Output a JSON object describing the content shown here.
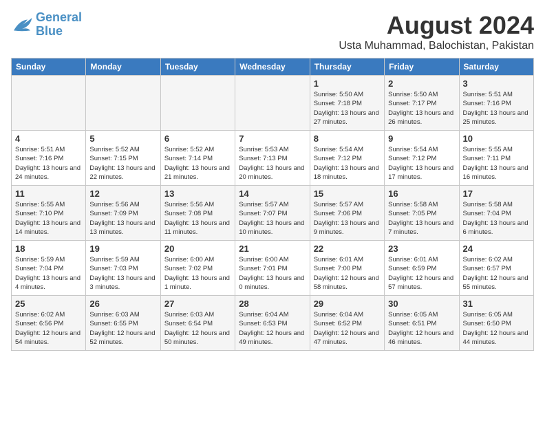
{
  "logo": {
    "line1": "General",
    "line2": "Blue"
  },
  "title": "August 2024",
  "subtitle": "Usta Muhammad, Balochistan, Pakistan",
  "headers": [
    "Sunday",
    "Monday",
    "Tuesday",
    "Wednesday",
    "Thursday",
    "Friday",
    "Saturday"
  ],
  "weeks": [
    [
      {
        "day": "",
        "sunrise": "",
        "sunset": "",
        "daylight": ""
      },
      {
        "day": "",
        "sunrise": "",
        "sunset": "",
        "daylight": ""
      },
      {
        "day": "",
        "sunrise": "",
        "sunset": "",
        "daylight": ""
      },
      {
        "day": "",
        "sunrise": "",
        "sunset": "",
        "daylight": ""
      },
      {
        "day": "1",
        "sunrise": "Sunrise: 5:50 AM",
        "sunset": "Sunset: 7:18 PM",
        "daylight": "Daylight: 13 hours and 27 minutes."
      },
      {
        "day": "2",
        "sunrise": "Sunrise: 5:50 AM",
        "sunset": "Sunset: 7:17 PM",
        "daylight": "Daylight: 13 hours and 26 minutes."
      },
      {
        "day": "3",
        "sunrise": "Sunrise: 5:51 AM",
        "sunset": "Sunset: 7:16 PM",
        "daylight": "Daylight: 13 hours and 25 minutes."
      }
    ],
    [
      {
        "day": "4",
        "sunrise": "Sunrise: 5:51 AM",
        "sunset": "Sunset: 7:16 PM",
        "daylight": "Daylight: 13 hours and 24 minutes."
      },
      {
        "day": "5",
        "sunrise": "Sunrise: 5:52 AM",
        "sunset": "Sunset: 7:15 PM",
        "daylight": "Daylight: 13 hours and 22 minutes."
      },
      {
        "day": "6",
        "sunrise": "Sunrise: 5:52 AM",
        "sunset": "Sunset: 7:14 PM",
        "daylight": "Daylight: 13 hours and 21 minutes."
      },
      {
        "day": "7",
        "sunrise": "Sunrise: 5:53 AM",
        "sunset": "Sunset: 7:13 PM",
        "daylight": "Daylight: 13 hours and 20 minutes."
      },
      {
        "day": "8",
        "sunrise": "Sunrise: 5:54 AM",
        "sunset": "Sunset: 7:12 PM",
        "daylight": "Daylight: 13 hours and 18 minutes."
      },
      {
        "day": "9",
        "sunrise": "Sunrise: 5:54 AM",
        "sunset": "Sunset: 7:12 PM",
        "daylight": "Daylight: 13 hours and 17 minutes."
      },
      {
        "day": "10",
        "sunrise": "Sunrise: 5:55 AM",
        "sunset": "Sunset: 7:11 PM",
        "daylight": "Daylight: 13 hours and 16 minutes."
      }
    ],
    [
      {
        "day": "11",
        "sunrise": "Sunrise: 5:55 AM",
        "sunset": "Sunset: 7:10 PM",
        "daylight": "Daylight: 13 hours and 14 minutes."
      },
      {
        "day": "12",
        "sunrise": "Sunrise: 5:56 AM",
        "sunset": "Sunset: 7:09 PM",
        "daylight": "Daylight: 13 hours and 13 minutes."
      },
      {
        "day": "13",
        "sunrise": "Sunrise: 5:56 AM",
        "sunset": "Sunset: 7:08 PM",
        "daylight": "Daylight: 13 hours and 11 minutes."
      },
      {
        "day": "14",
        "sunrise": "Sunrise: 5:57 AM",
        "sunset": "Sunset: 7:07 PM",
        "daylight": "Daylight: 13 hours and 10 minutes."
      },
      {
        "day": "15",
        "sunrise": "Sunrise: 5:57 AM",
        "sunset": "Sunset: 7:06 PM",
        "daylight": "Daylight: 13 hours and 9 minutes."
      },
      {
        "day": "16",
        "sunrise": "Sunrise: 5:58 AM",
        "sunset": "Sunset: 7:05 PM",
        "daylight": "Daylight: 13 hours and 7 minutes."
      },
      {
        "day": "17",
        "sunrise": "Sunrise: 5:58 AM",
        "sunset": "Sunset: 7:04 PM",
        "daylight": "Daylight: 13 hours and 6 minutes."
      }
    ],
    [
      {
        "day": "18",
        "sunrise": "Sunrise: 5:59 AM",
        "sunset": "Sunset: 7:04 PM",
        "daylight": "Daylight: 13 hours and 4 minutes."
      },
      {
        "day": "19",
        "sunrise": "Sunrise: 5:59 AM",
        "sunset": "Sunset: 7:03 PM",
        "daylight": "Daylight: 13 hours and 3 minutes."
      },
      {
        "day": "20",
        "sunrise": "Sunrise: 6:00 AM",
        "sunset": "Sunset: 7:02 PM",
        "daylight": "Daylight: 13 hours and 1 minute."
      },
      {
        "day": "21",
        "sunrise": "Sunrise: 6:00 AM",
        "sunset": "Sunset: 7:01 PM",
        "daylight": "Daylight: 13 hours and 0 minutes."
      },
      {
        "day": "22",
        "sunrise": "Sunrise: 6:01 AM",
        "sunset": "Sunset: 7:00 PM",
        "daylight": "Daylight: 12 hours and 58 minutes."
      },
      {
        "day": "23",
        "sunrise": "Sunrise: 6:01 AM",
        "sunset": "Sunset: 6:59 PM",
        "daylight": "Daylight: 12 hours and 57 minutes."
      },
      {
        "day": "24",
        "sunrise": "Sunrise: 6:02 AM",
        "sunset": "Sunset: 6:57 PM",
        "daylight": "Daylight: 12 hours and 55 minutes."
      }
    ],
    [
      {
        "day": "25",
        "sunrise": "Sunrise: 6:02 AM",
        "sunset": "Sunset: 6:56 PM",
        "daylight": "Daylight: 12 hours and 54 minutes."
      },
      {
        "day": "26",
        "sunrise": "Sunrise: 6:03 AM",
        "sunset": "Sunset: 6:55 PM",
        "daylight": "Daylight: 12 hours and 52 minutes."
      },
      {
        "day": "27",
        "sunrise": "Sunrise: 6:03 AM",
        "sunset": "Sunset: 6:54 PM",
        "daylight": "Daylight: 12 hours and 50 minutes."
      },
      {
        "day": "28",
        "sunrise": "Sunrise: 6:04 AM",
        "sunset": "Sunset: 6:53 PM",
        "daylight": "Daylight: 12 hours and 49 minutes."
      },
      {
        "day": "29",
        "sunrise": "Sunrise: 6:04 AM",
        "sunset": "Sunset: 6:52 PM",
        "daylight": "Daylight: 12 hours and 47 minutes."
      },
      {
        "day": "30",
        "sunrise": "Sunrise: 6:05 AM",
        "sunset": "Sunset: 6:51 PM",
        "daylight": "Daylight: 12 hours and 46 minutes."
      },
      {
        "day": "31",
        "sunrise": "Sunrise: 6:05 AM",
        "sunset": "Sunset: 6:50 PM",
        "daylight": "Daylight: 12 hours and 44 minutes."
      }
    ]
  ]
}
